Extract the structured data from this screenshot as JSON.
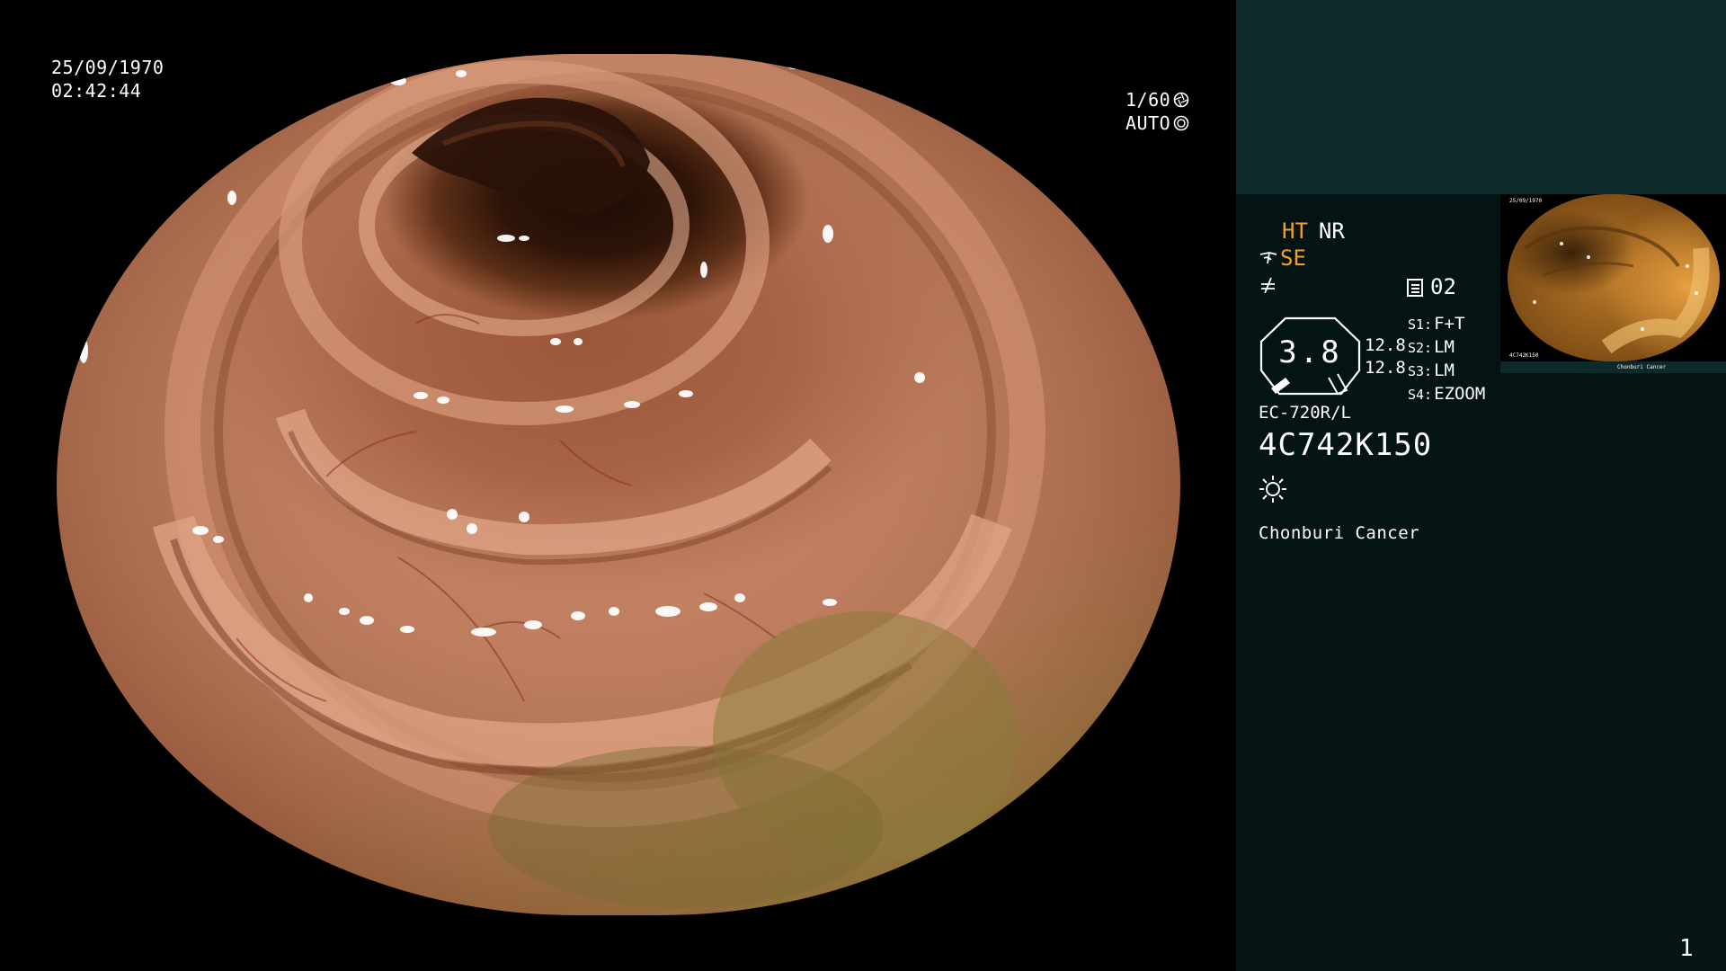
{
  "exam": {
    "date": "25/09/1970",
    "time": "02:42:44",
    "shutter": "1/60",
    "exposure_mode": "AUTO"
  },
  "panel": {
    "mode_primary": "HT",
    "mode_secondary": "NR",
    "structure_enhance": "SE",
    "memory_number": "02",
    "zoom_value": "3.8",
    "range_values": [
      "12.8",
      "12.8"
    ],
    "switch_settings": [
      {
        "key": "S1:",
        "value": "F+T"
      },
      {
        "key": "S2:",
        "value": "LM"
      },
      {
        "key": "S3:",
        "value": "LM"
      },
      {
        "key": "S4:",
        "value": "EZOOM"
      }
    ],
    "scope_model": "EC-720R/L",
    "scope_serial": "4C742K150",
    "hospital_name": "Chonburi Cancer",
    "page_number": "1"
  },
  "thumbnail": {
    "date": "25/09/1970",
    "serial": "4C742K150",
    "hospital_name": "Chonburi Cancer"
  },
  "colors": {
    "accent_orange": "#f5a020",
    "panel_top_bg": "#0e2a2a",
    "panel_bg": "#041313"
  },
  "icons": [
    "aperture-icon",
    "exposure-auto-icon",
    "scope-icon",
    "function-icon",
    "memory-icon",
    "zoom-gauge-icon",
    "light-source-icon"
  ]
}
